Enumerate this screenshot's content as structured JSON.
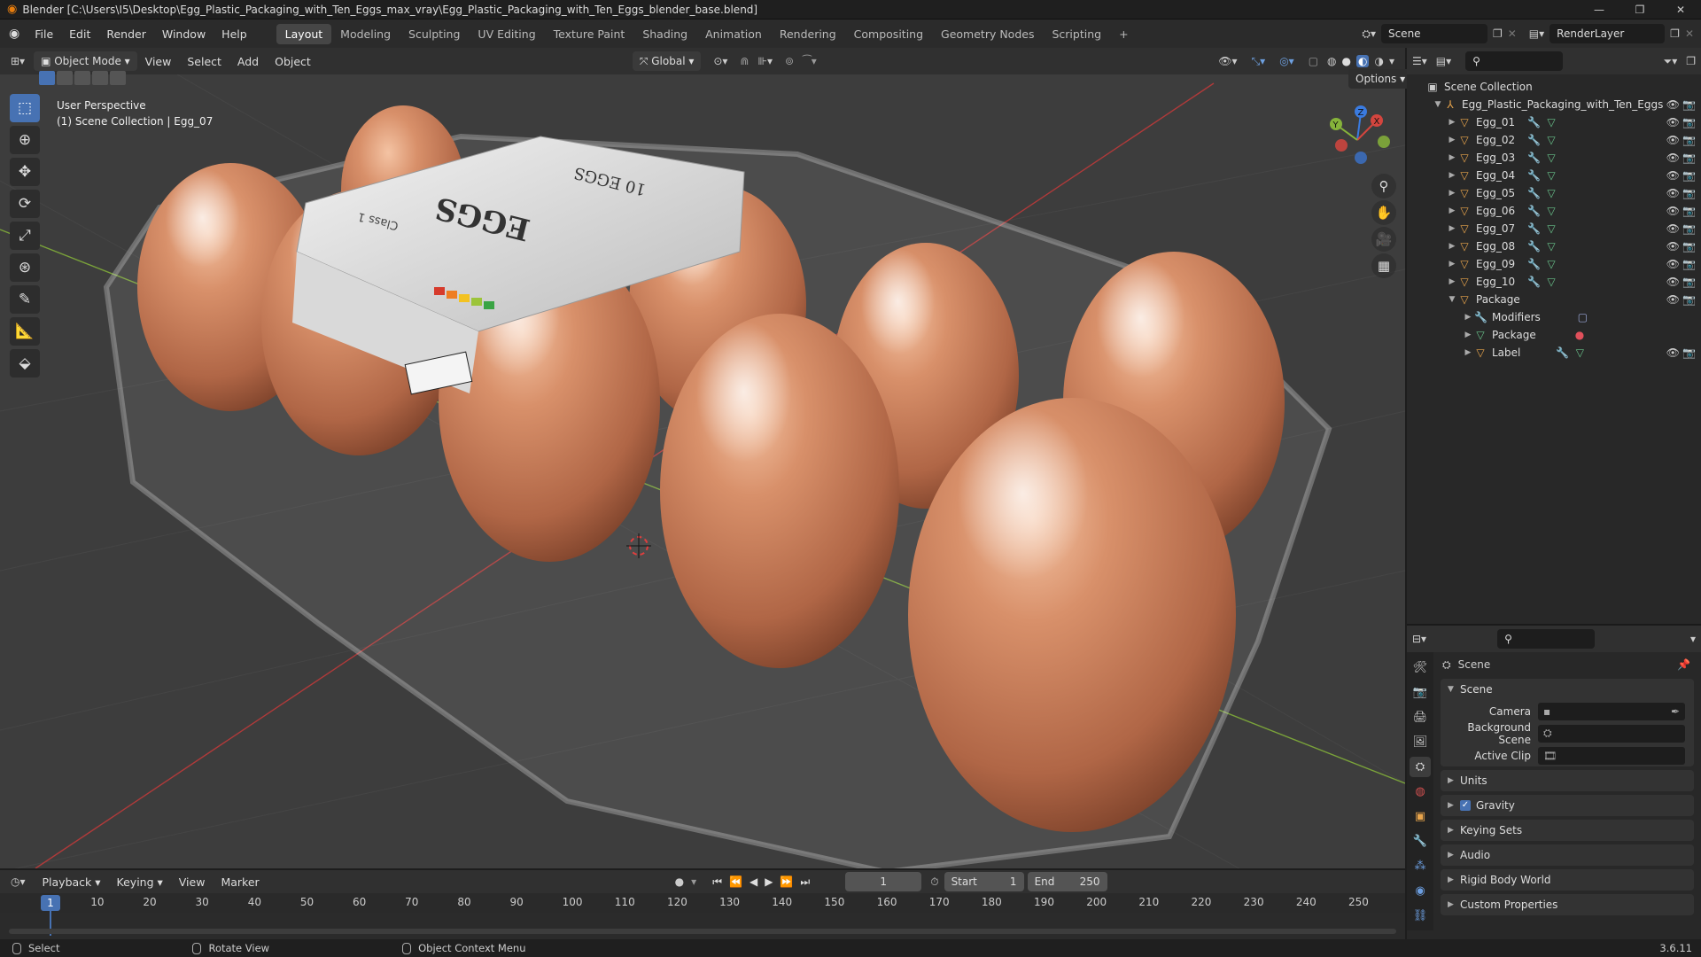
{
  "window": {
    "title": "Blender [C:\\Users\\I5\\Desktop\\Egg_Plastic_Packaging_with_Ten_Eggs_max_vray\\Egg_Plastic_Packaging_with_Ten_Eggs_blender_base.blend]",
    "minimize": "—",
    "maximize": "❐",
    "close": "✕"
  },
  "menu": {
    "items": [
      "File",
      "Edit",
      "Render",
      "Window",
      "Help"
    ],
    "workspaces": [
      "Layout",
      "Modeling",
      "Sculpting",
      "UV Editing",
      "Texture Paint",
      "Shading",
      "Animation",
      "Rendering",
      "Compositing",
      "Geometry Nodes",
      "Scripting"
    ],
    "add_workspace": "+",
    "scene": "Scene",
    "view_layer": "RenderLayer"
  },
  "viewport_header": {
    "mode": "Object Mode",
    "menus": [
      "View",
      "Select",
      "Add",
      "Object"
    ],
    "transform_orientation": "Global",
    "options": "Options"
  },
  "viewport": {
    "perspective": "User Perspective",
    "context": "(1) Scene Collection | Egg_07",
    "gizmo_axes": {
      "x": "X",
      "y": "Y",
      "z": "Z"
    },
    "label_text": {
      "brand": "EGGS",
      "count": "10 EGGS",
      "grade": "Class 1"
    },
    "colors": {
      "background": "#3d3d3d",
      "egg": "#c77a55",
      "x_axis": "#b03a3a",
      "y_axis": "#7aa23a",
      "accent": "#4772b3"
    }
  },
  "outliner": {
    "root": "Scene Collection",
    "collection": "Egg_Plastic_Packaging_with_Ten_Eggs",
    "eggs": [
      "Egg_01",
      "Egg_02",
      "Egg_03",
      "Egg_04",
      "Egg_05",
      "Egg_06",
      "Egg_07",
      "Egg_08",
      "Egg_09",
      "Egg_10"
    ],
    "package": "Package",
    "package_children": [
      "Modifiers",
      "Package",
      "Label"
    ]
  },
  "properties": {
    "breadcrumb": "Scene",
    "panel_title": "Scene",
    "camera_label": "Camera",
    "background_scene_label": "Background Scene",
    "active_clip_label": "Active Clip",
    "sections": [
      "Units",
      "Gravity",
      "Keying Sets",
      "Audio",
      "Rigid Body World",
      "Custom Properties"
    ],
    "gravity_enabled": true
  },
  "timeline": {
    "menus": [
      "Playback",
      "Keying",
      "View",
      "Marker"
    ],
    "current_frame": "1",
    "start_label": "Start",
    "start": "1",
    "end_label": "End",
    "end": "250",
    "ruler": [
      "1",
      "10",
      "20",
      "30",
      "40",
      "50",
      "60",
      "70",
      "80",
      "90",
      "100",
      "110",
      "120",
      "130",
      "140",
      "150",
      "160",
      "170",
      "180",
      "190",
      "200",
      "210",
      "220",
      "230",
      "240",
      "250"
    ]
  },
  "status": {
    "select": "Select",
    "rotate": "Rotate View",
    "context_menu": "Object Context Menu",
    "version": "3.6.11"
  }
}
